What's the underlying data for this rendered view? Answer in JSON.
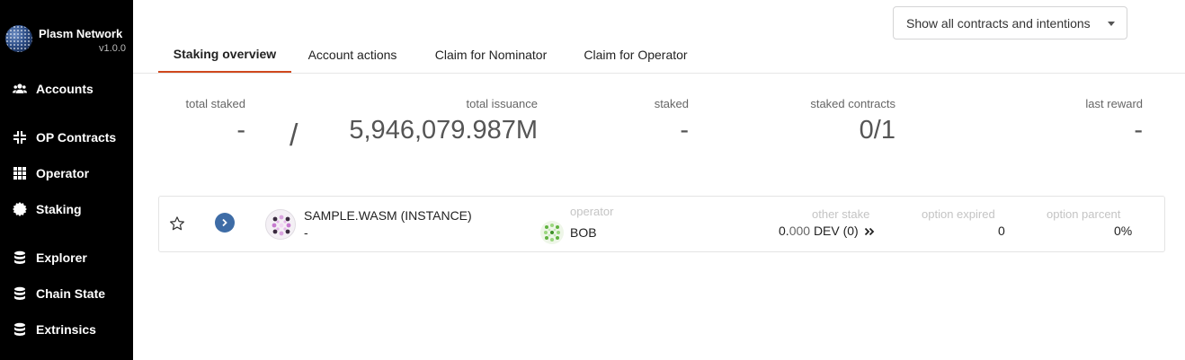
{
  "sidebar": {
    "brand_name": "Plasm Network",
    "brand_version": "v1.0.0",
    "items": [
      {
        "label": "Accounts",
        "icon": "users-icon"
      },
      {
        "label": "OP Contracts",
        "icon": "compress-icon"
      },
      {
        "label": "Operator",
        "icon": "grid-icon"
      },
      {
        "label": "Staking",
        "icon": "certificate-icon"
      },
      {
        "label": "Explorer",
        "icon": "database-icon"
      },
      {
        "label": "Chain State",
        "icon": "database-icon"
      },
      {
        "label": "Extrinsics",
        "icon": "database-icon"
      }
    ]
  },
  "filter": {
    "label": "Show all contracts and intentions"
  },
  "tabs": [
    {
      "label": "Staking overview",
      "active": true
    },
    {
      "label": "Account actions",
      "active": false
    },
    {
      "label": "Claim for Nominator",
      "active": false
    },
    {
      "label": "Claim for Operator",
      "active": false
    }
  ],
  "summary": {
    "total_staked": {
      "label": "total staked",
      "value": "-"
    },
    "separator": "/",
    "total_issuance": {
      "label": "total issuance",
      "value": "5,946,079.987M"
    },
    "staked": {
      "label": "staked",
      "value": "-"
    },
    "staked_contracts": {
      "label": "staked contracts",
      "value": "0/1"
    },
    "last_reward": {
      "label": "last reward",
      "value": "-"
    }
  },
  "contract": {
    "name": "SAMPLE.WASM (INSTANCE)",
    "sub": "-",
    "operator_label": "operator",
    "operator_value": "BOB",
    "other_stake_label": "other stake",
    "other_stake_whole": "0.",
    "other_stake_frac": "000",
    "other_stake_unit": "DEV (0)",
    "option_expired_label": "option expired",
    "option_expired_value": "0",
    "option_parcent_label": "option parcent",
    "option_parcent_value": "0%"
  },
  "colors": {
    "sidebar_bg": "#000000",
    "active_tab_underline": "#d0491e",
    "expand_button": "#3e6ca6"
  }
}
